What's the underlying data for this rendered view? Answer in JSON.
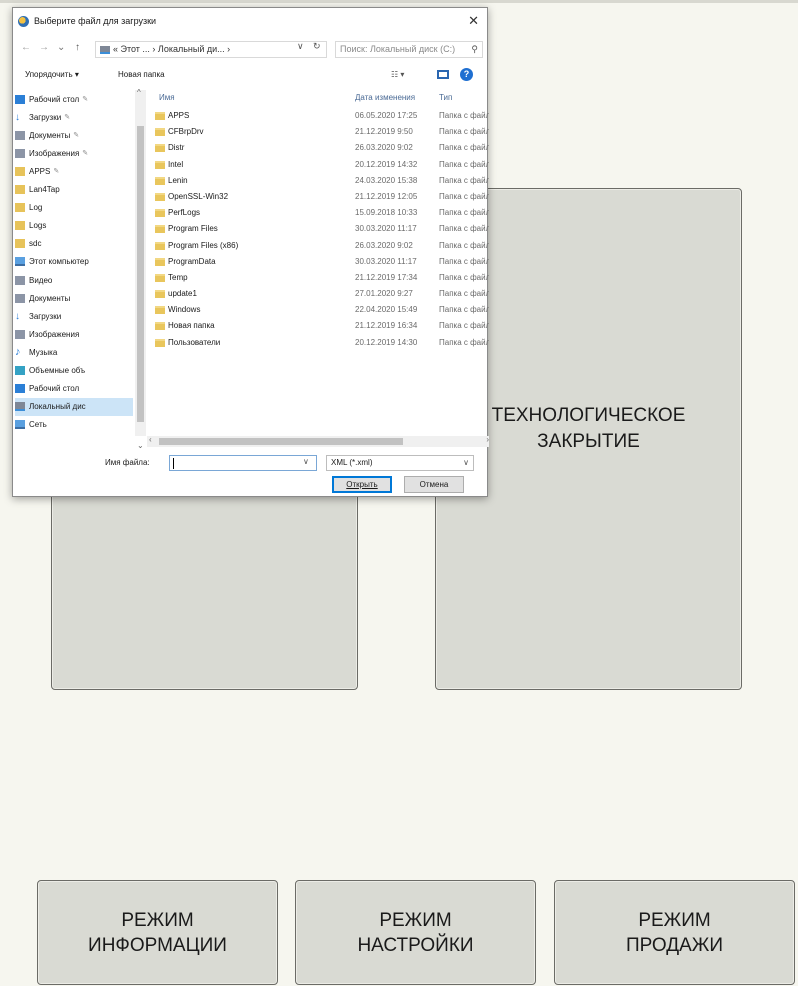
{
  "dialog": {
    "title": "Выберите файл для загрузки",
    "close_glyph": "✕",
    "nav_back": "←",
    "nav_forward": "→",
    "nav_up": "↑",
    "breadcrumb": "« Этот ... › Локальный ди... ›",
    "path_dropdown": "∨",
    "refresh": "↻",
    "search_placeholder": "Поиск: Локальный диск (C:)",
    "toolbar": {
      "organize": "Упорядочить ▾",
      "new_folder": "Новая папка",
      "view_menu": "☷ ▾"
    },
    "nav_items": [
      {
        "label": "Рабочий стол",
        "icon": "blue",
        "pinned": true
      },
      {
        "label": "Загрузки",
        "icon": "arrow",
        "pinned": true
      },
      {
        "label": "Документы",
        "icon": "gray",
        "pinned": true
      },
      {
        "label": "Изображения",
        "icon": "gray",
        "pinned": true
      },
      {
        "label": "APPS",
        "icon": "yellow",
        "pinned": true
      },
      {
        "label": "Lan4Tap",
        "icon": "yellow",
        "pinned": false
      },
      {
        "label": "Log",
        "icon": "yellow",
        "pinned": false
      },
      {
        "label": "Logs",
        "icon": "yellow",
        "pinned": false
      },
      {
        "label": "sdc",
        "icon": "yellow",
        "pinned": false
      },
      {
        "label": "Этот компьютер",
        "icon": "pc",
        "pinned": false
      },
      {
        "label": "Видео",
        "icon": "gray",
        "pinned": false
      },
      {
        "label": "Документы",
        "icon": "gray",
        "pinned": false
      },
      {
        "label": "Загрузки",
        "icon": "arrow",
        "pinned": false
      },
      {
        "label": "Изображения",
        "icon": "gray",
        "pinned": false
      },
      {
        "label": "Музыка",
        "icon": "music",
        "pinned": false
      },
      {
        "label": "Объемные объ",
        "icon": "obj",
        "pinned": false
      },
      {
        "label": "Рабочий стол",
        "icon": "blue",
        "pinned": false
      },
      {
        "label": "Локальный дис",
        "icon": "drive",
        "pinned": false,
        "selected": true
      },
      {
        "label": "Сеть",
        "icon": "pc",
        "pinned": false
      }
    ],
    "columns": {
      "name": "Имя",
      "date": "Дата изменения",
      "type": "Тип"
    },
    "files": [
      {
        "name": "APPS",
        "date": "06.05.2020 17:25",
        "type": "Папка с файлами"
      },
      {
        "name": "CFBrpDrv",
        "date": "21.12.2019 9:50",
        "type": "Папка с файлами"
      },
      {
        "name": "Distr",
        "date": "26.03.2020 9:02",
        "type": "Папка с файлами"
      },
      {
        "name": "Intel",
        "date": "20.12.2019 14:32",
        "type": "Папка с файлами"
      },
      {
        "name": "Lenin",
        "date": "24.03.2020 15:38",
        "type": "Папка с файлами"
      },
      {
        "name": "OpenSSL-Win32",
        "date": "21.12.2019 12:05",
        "type": "Папка с файлами"
      },
      {
        "name": "PerfLogs",
        "date": "15.09.2018 10:33",
        "type": "Папка с файлами"
      },
      {
        "name": "Program Files",
        "date": "30.03.2020 11:17",
        "type": "Папка с файлами"
      },
      {
        "name": "Program Files (x86)",
        "date": "26.03.2020 9:02",
        "type": "Папка с файлами"
      },
      {
        "name": "ProgramData",
        "date": "30.03.2020 11:17",
        "type": "Папка с файлами"
      },
      {
        "name": "Temp",
        "date": "21.12.2019 17:34",
        "type": "Папка с файлами"
      },
      {
        "name": "update1",
        "date": "27.01.2020 9:27",
        "type": "Папка с файлами"
      },
      {
        "name": "Windows",
        "date": "22.04.2020 15:49",
        "type": "Папка с файлами"
      },
      {
        "name": "Новая папка",
        "date": "21.12.2019 16:34",
        "type": "Папка с файлами"
      },
      {
        "name": "Пользователи",
        "date": "20.12.2019 14:30",
        "type": "Папка с файлами"
      }
    ],
    "filename_label": "Имя файла:",
    "filename_value": "",
    "filename_dropdown": "∨",
    "filter_value": "XML (*.xml)",
    "filter_dropdown": "∨",
    "open_label": "Открыть",
    "cancel_label": "Отмена",
    "help_glyph": "?"
  },
  "tiles": {
    "technological_closing": "ТЕХНОЛОГИЧЕСКОЕ ЗАКРЫТИЕ"
  },
  "modes": {
    "info": "РЕЖИМ ИНФОРМАЦИИ",
    "settings": "РЕЖИМ НАСТРОЙКИ",
    "sale": "РЕЖИМ ПРОДАЖИ"
  },
  "colors": {
    "background": "#f6f6ef",
    "tile": "#d9dad3",
    "accent": "#0078d7"
  }
}
